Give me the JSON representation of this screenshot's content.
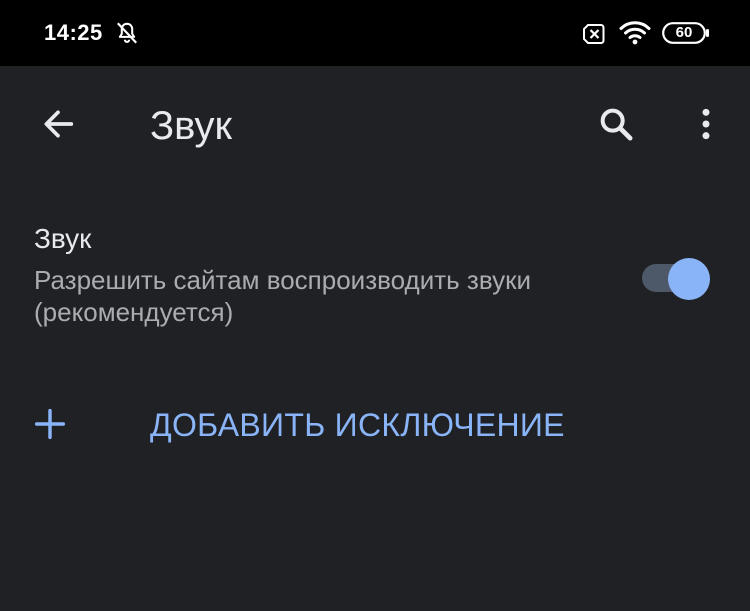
{
  "status_bar": {
    "time": "14:25",
    "battery": "60",
    "icons": [
      "bell-off-icon",
      "sim-off-icon",
      "wifi-icon",
      "battery-icon"
    ]
  },
  "toolbar": {
    "title": "Звук",
    "back_icon": "arrow-back-icon",
    "search_icon": "search-icon",
    "more_icon": "more-vert-icon"
  },
  "setting": {
    "title": "Звук",
    "summary": "Разрешить сайтам воспроизводить звуки (рекомендуется)",
    "toggle_on": true
  },
  "add_exception": {
    "icon": "plus-icon",
    "label": "ДОБАВИТЬ ИСКЛЮЧЕНИЕ"
  },
  "colors": {
    "background": "#202124",
    "status_bar": "#000000",
    "accent": "#8ab4f8",
    "toggle_track": "#4d5868",
    "primary_text": "#e8eaed",
    "secondary_text": "#a9adb2"
  }
}
